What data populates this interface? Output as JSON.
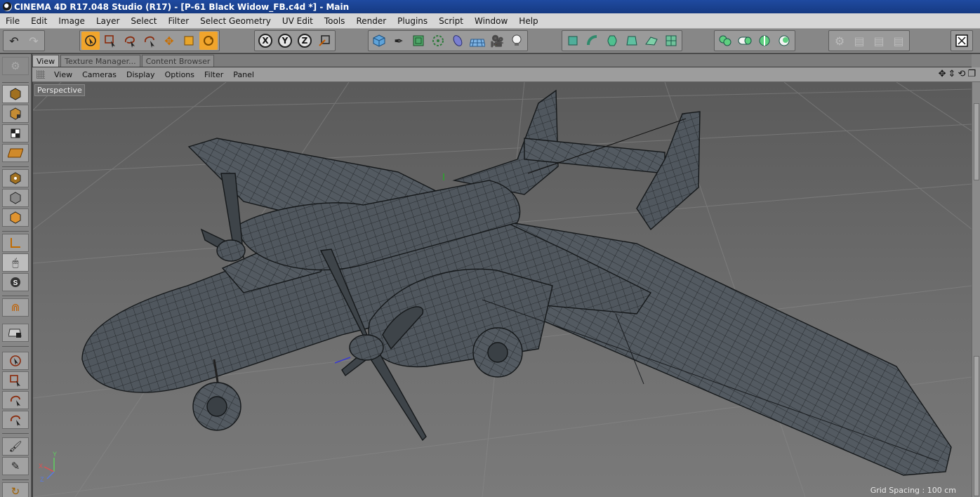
{
  "window": {
    "title": "CINEMA 4D R17.048 Studio (R17) - [P-61 Black Widow_FB.c4d *] - Main"
  },
  "menu": [
    "File",
    "Edit",
    "Image",
    "Layer",
    "Select",
    "Filter",
    "Select Geometry",
    "UV Edit",
    "Tools",
    "Render",
    "Plugins",
    "Script",
    "Window",
    "Help"
  ],
  "toolbar": {
    "axis_x": "X",
    "axis_y": "Y",
    "axis_z": "Z"
  },
  "tabs": [
    "View",
    "Texture Manager...",
    "Content Browser"
  ],
  "viewport_menu": [
    "View",
    "Cameras",
    "Display",
    "Options",
    "Filter",
    "Panel"
  ],
  "viewport": {
    "camera_label": "Perspective",
    "grid_spacing": "Grid Spacing : 100 cm",
    "axis_x": "X",
    "axis_y": "Y",
    "axis_z": "Z"
  },
  "colors": {
    "accent": "#f1a52c",
    "titlebar": "#1f4aa0",
    "model_fill": "#4f565d",
    "wire": "#1c1f22"
  }
}
